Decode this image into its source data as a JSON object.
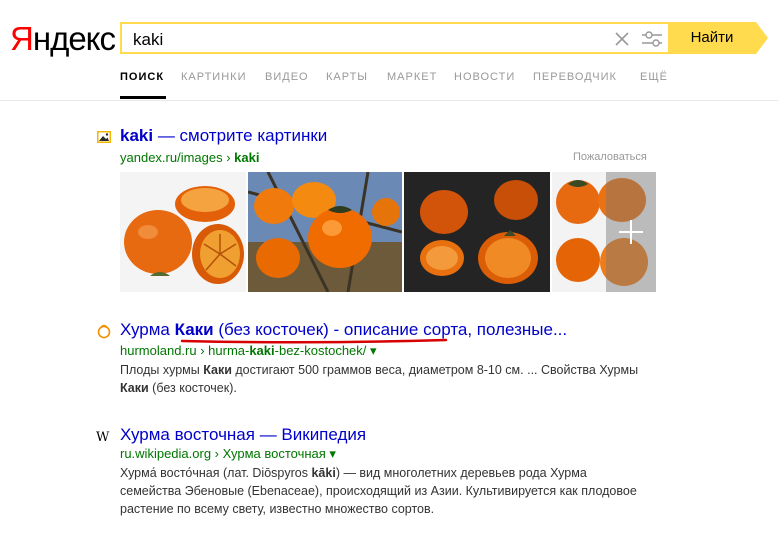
{
  "header": {
    "logo_first": "Я",
    "logo_rest": "ндекс",
    "query": "kaki",
    "find_label": "Найти"
  },
  "tabs": [
    {
      "label": "ПОИСК"
    },
    {
      "label": "КАРТИНКИ"
    },
    {
      "label": "ВИДЕО"
    },
    {
      "label": "КАРТЫ"
    },
    {
      "label": "МАРКЕТ"
    },
    {
      "label": "НОВОСТИ"
    },
    {
      "label": "ПЕРЕВОДЧИК"
    },
    {
      "label": "ЕЩЁ"
    }
  ],
  "images_result": {
    "title_bold": "kaki",
    "title_rest": " — смотрите картинки",
    "url_plain": "yandex.ru/images › ",
    "url_bold": "kaki",
    "complain": "Пожаловаться"
  },
  "results": [
    {
      "title_a": "Хурма ",
      "title_bold": "Каки",
      "title_b": " (без косточек) - описание сорта, полезные...",
      "url_a": "hurmoland.ru › hurma-",
      "url_bold": "kaki",
      "url_b": "-bez-kostochek/ ▾",
      "snippet_a": "Плоды хурмы ",
      "snippet_b1": "Каки",
      "snippet_c": " достигают 500 граммов веса, диаметром 8-10 см. ... Свойства Хурмы ",
      "snippet_b2": "Каки",
      "snippet_d": " (без косточек)."
    },
    {
      "title": "Хурма восточная — Википедия",
      "url": "ru.wikipedia.org › Хурма восточная ▾",
      "snippet_a": "Хурма́ восто́чная (лат. Diōspyros ",
      "snippet_bold": "kāki",
      "snippet_b": ") — вид многолетних деревьев рода Хурма семейства Эбеновые (Ebenaceae), происходящий из Азии. Культивируется как плодовое растение по всему свету, известно множество сортов."
    }
  ],
  "colors": {
    "accent": "#ffdb4d",
    "link": "#0000cc",
    "url": "#007700",
    "annotation": "#d60000"
  },
  "icons": [
    "clear-icon",
    "settings-icon",
    "images-icon",
    "favicon-persimmon-icon",
    "wikipedia-icon",
    "plus-icon"
  ]
}
